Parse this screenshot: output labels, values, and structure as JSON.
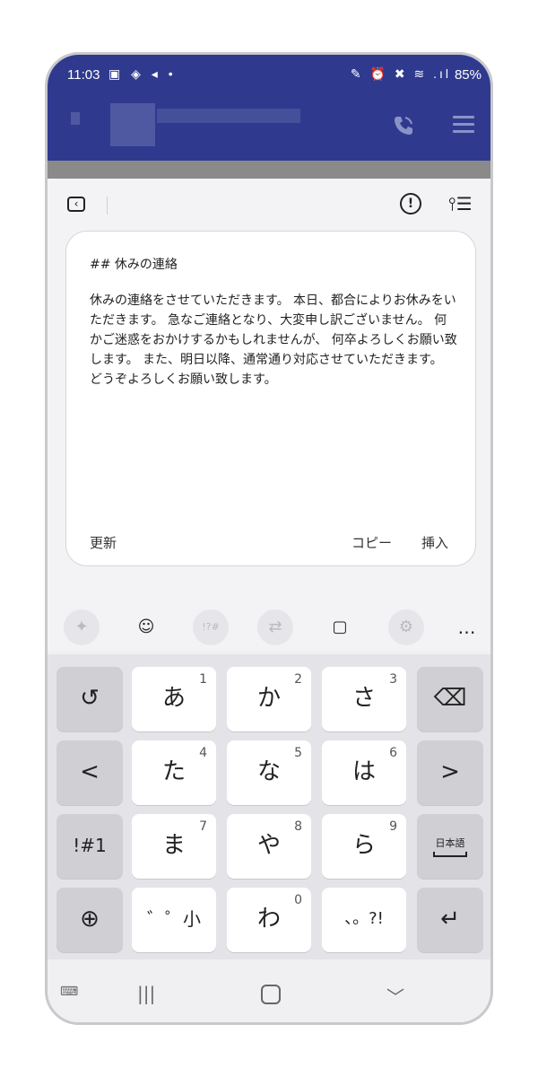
{
  "status": {
    "time": "11:03",
    "battery": "85%",
    "left_icons": "▣ ◈ ◂ •",
    "right_icons": "✎ ⏰ ✖ ≋ .ıl"
  },
  "card": {
    "heading": "## 休みの連絡",
    "body": "休みの連絡をさせていただきます。 本日、都合によりお休みをいただきます。 急なご連絡となり、大変申し訳ございません。 何かご迷惑をおかけするかもしれませんが、 何卒よろしくお願い致します。 また、明日以降、通常通り対応させていただきます。 どうぞよろしくお願い致します。",
    "update_label": "更新",
    "copy_label": "コピー",
    "insert_label": "挿入"
  },
  "toolbar": {
    "more": "…"
  },
  "keys": {
    "r1": [
      {
        "main": "あ",
        "num": "1"
      },
      {
        "main": "か",
        "num": "2"
      },
      {
        "main": "さ",
        "num": "3"
      }
    ],
    "r2": [
      {
        "main": "た",
        "num": "4"
      },
      {
        "main": "な",
        "num": "5"
      },
      {
        "main": "は",
        "num": "6"
      }
    ],
    "r3": [
      {
        "main": "ま",
        "num": "7"
      },
      {
        "main": "や",
        "num": "8"
      },
      {
        "main": "ら",
        "num": "9"
      }
    ],
    "r4": [
      {
        "main": "゛゜小",
        "num": ""
      },
      {
        "main": "わ",
        "num": "0"
      },
      {
        "main": "、。?!",
        "num": ""
      }
    ],
    "symbol": "!#1",
    "lang": "日本語",
    "left": "<",
    "right": ">"
  },
  "colors": {
    "header": "#2f3a8f",
    "panel": "#f3f3f5",
    "key": "#ffffff",
    "func_key": "#cfcfd4"
  }
}
